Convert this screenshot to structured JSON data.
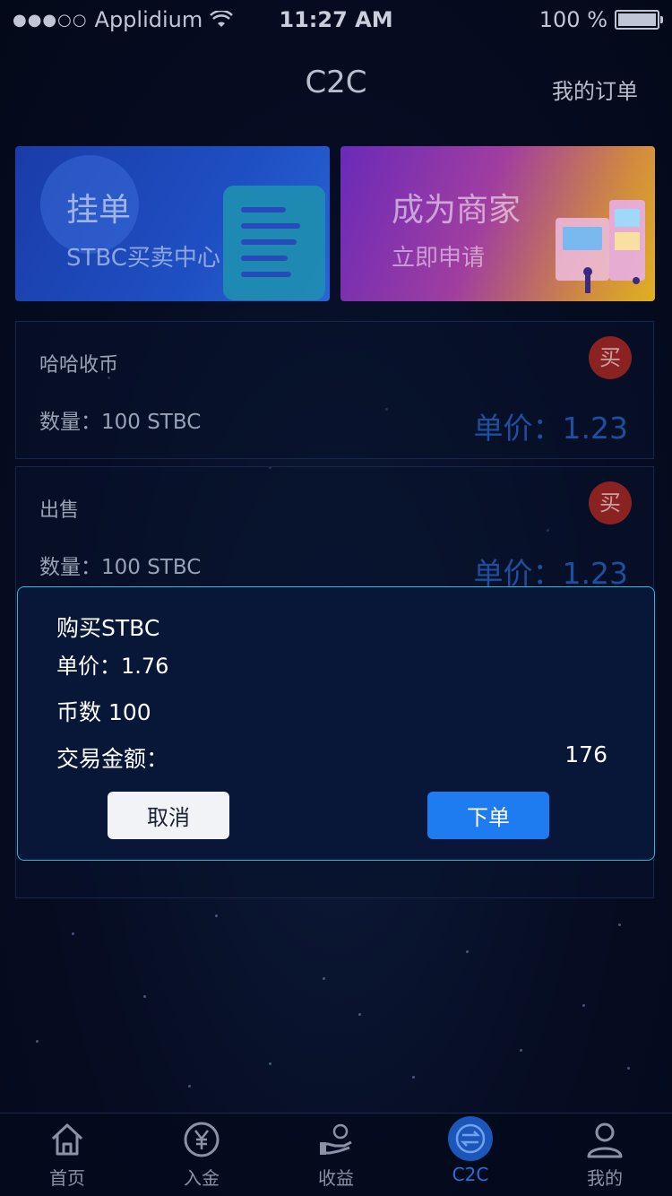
{
  "status_bar": {
    "carrier": "Applidium",
    "signal_dots": "●●●○○",
    "time": "11:27 AM",
    "battery": "100 %"
  },
  "nav": {
    "title": "C2C",
    "right_link": "我的订单"
  },
  "banners": [
    {
      "title": "挂单",
      "subtitle": "STBC买卖中心"
    },
    {
      "title": "成为商家",
      "subtitle": "立即申请"
    }
  ],
  "orders": [
    {
      "name": "哈哈收币",
      "quantity": "数量：100 STBC",
      "price": "单价：1.23",
      "badge": "买"
    },
    {
      "name": "出售",
      "quantity": "数量：100 STBC",
      "price": "单价：1.23",
      "badge": "买"
    }
  ],
  "modal": {
    "title": "购买STBC",
    "price": "单价：1.76",
    "count": "币数 100",
    "amount_label": "交易金额：",
    "amount_value": "176",
    "cancel_label": "取消",
    "order_label": "下单"
  },
  "tabbar": {
    "items": [
      {
        "label": "首页",
        "icon": "home-icon"
      },
      {
        "label": "入金",
        "icon": "yen-icon"
      },
      {
        "label": "收益",
        "icon": "earnings-icon"
      },
      {
        "label": "C2C",
        "icon": "exchange-icon",
        "active": true
      },
      {
        "label": "我的",
        "icon": "user-icon"
      }
    ]
  },
  "colors": {
    "accent": "#1e7bf0",
    "price_text": "#1e4f9e",
    "buy_badge": "#8a2222",
    "modal_border": "#2fb6d6"
  }
}
